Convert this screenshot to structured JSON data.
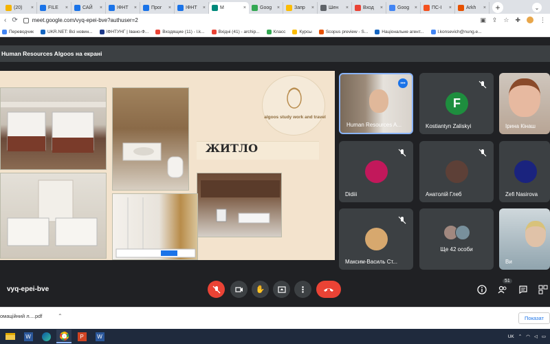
{
  "browser": {
    "tabs": [
      {
        "label": "(20)",
        "color": "#f4b400",
        "active": false
      },
      {
        "label": "FILE",
        "color": "#1a73e8",
        "active": false
      },
      {
        "label": "САЙ",
        "color": "#1a73e8",
        "active": false
      },
      {
        "label": "ІФНТ",
        "color": "#1a73e8",
        "active": false
      },
      {
        "label": "Прог",
        "color": "#1a73e8",
        "active": false
      },
      {
        "label": "ІФНТ",
        "color": "#1a73e8",
        "active": false
      },
      {
        "label": "M",
        "color": "#00897b",
        "active": true
      },
      {
        "label": "Goog",
        "color": "#34a853",
        "active": false
      },
      {
        "label": "Запр",
        "color": "#fbbc04",
        "active": false
      },
      {
        "label": "Шен",
        "color": "#5f6368",
        "active": false
      },
      {
        "label": "Вход",
        "color": "#ea4335",
        "active": false
      },
      {
        "label": "Goog",
        "color": "#4285f4",
        "active": false
      },
      {
        "label": "ПС-І",
        "color": "#f4511e",
        "active": false
      },
      {
        "label": "Arkh",
        "color": "#e65100",
        "active": false
      }
    ],
    "url": "meet.google.com/vyq-epei-bve?authuser=2",
    "bookmarks": [
      {
        "label": "Переводчик",
        "color": "#4285f4"
      },
      {
        "label": "UKR.NET: Всі новин...",
        "color": "#1565c0"
      },
      {
        "label": "ІФНТУНГ | Івано-Ф...",
        "color": "#1e3a8a"
      },
      {
        "label": "Входящие (11) - l.k...",
        "color": "#ea4335"
      },
      {
        "label": "Вхідні (41) - archip...",
        "color": "#ea4335"
      },
      {
        "label": "Класс",
        "color": "#34a853"
      },
      {
        "label": "Курсы",
        "color": "#fbbc04"
      },
      {
        "label": "Scopus preview - S...",
        "color": "#e65100"
      },
      {
        "label": "Національне агент...",
        "color": "#1565c0"
      },
      {
        "label": "l.konsevich@nung.e...",
        "color": "#4285f4"
      }
    ]
  },
  "meet": {
    "presenter_banner": "Human Resources Algoos на екрані",
    "slide": {
      "heading": "ЖИТЛО",
      "logo_text": "algoos study work and travel"
    },
    "participants": [
      {
        "name": "Human Resources A...",
        "avatar_letter": "",
        "avatar_color": "",
        "kind": "video",
        "speaking": true
      },
      {
        "name": "Kostiantyn Zaliskyi",
        "avatar_letter": "F",
        "avatar_color": "#1e8e3e",
        "kind": "letter",
        "muted": true
      },
      {
        "name": "Ірина Кінаш",
        "avatar_letter": "",
        "avatar_color": "",
        "kind": "video-partial"
      },
      {
        "name": "Didiii",
        "avatar_letter": "",
        "avatar_color": "#c2185b",
        "kind": "photo",
        "muted": true
      },
      {
        "name": "Анатолій Глеб",
        "avatar_letter": "",
        "avatar_color": "#5d4037",
        "kind": "photo",
        "muted": true
      },
      {
        "name": "Zefi Nasirova",
        "avatar_letter": "",
        "avatar_color": "#1a237e",
        "kind": "photo",
        "muted": false
      },
      {
        "name": "Максим-Василь Ст...",
        "avatar_letter": "",
        "avatar_color": "#d7a86e",
        "kind": "photo",
        "muted": true
      },
      {
        "name": "Ще 42 особи",
        "avatar_letter": "",
        "avatar_color": "",
        "kind": "group"
      },
      {
        "name": "Ви",
        "avatar_letter": "",
        "avatar_color": "",
        "kind": "self-video"
      }
    ],
    "meeting_code": "vyq-epei-bve",
    "participants_count": "51",
    "colors": {
      "red": "#ea4335",
      "tile": "#3c4043",
      "bg": "#202124"
    }
  },
  "downloads": {
    "item": "омаційний л....pdf",
    "show_all": "Показат"
  },
  "taskbar": {
    "lang": "UK"
  }
}
